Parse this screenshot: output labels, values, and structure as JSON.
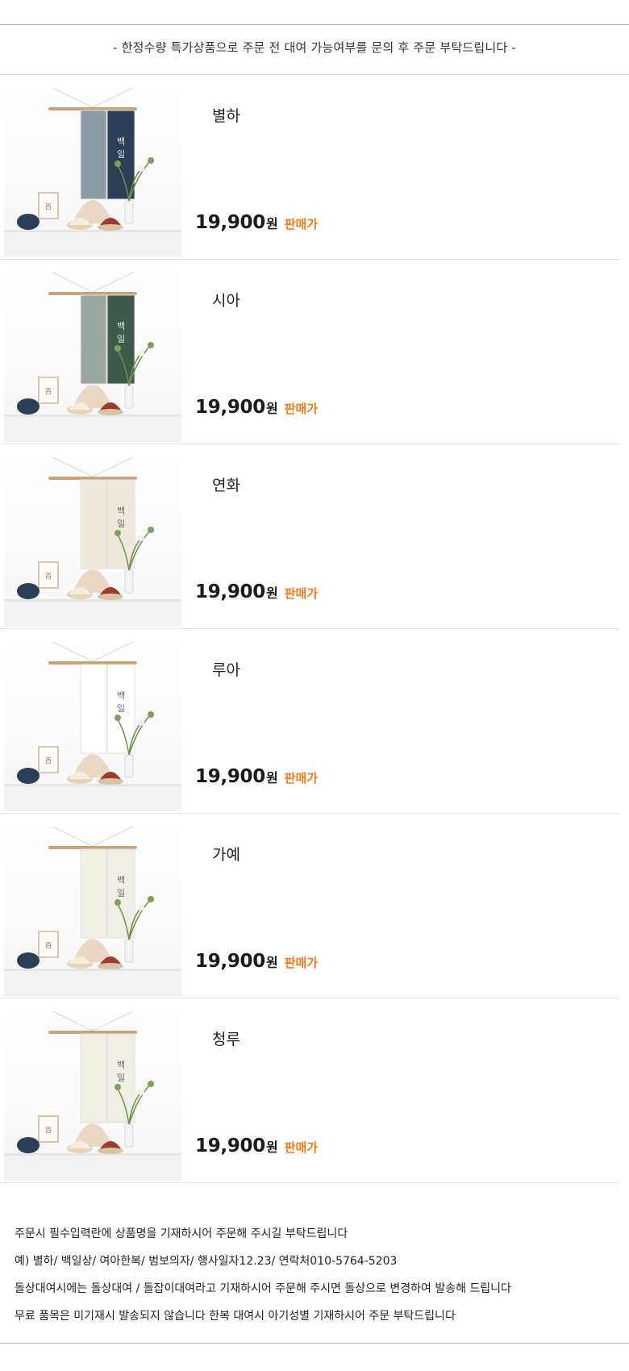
{
  "notice": "- 한정수량 특가상품으로 주문 전 대여 가능여부를 문의 후 주문 부탁드립니다 -",
  "products": [
    {
      "name": "별하",
      "price": "19,900",
      "unit": "원",
      "tag": "판매가",
      "banner_text": "백일",
      "banner_color": "#2c3e55",
      "panel_color": "#8e9aa3"
    },
    {
      "name": "시아",
      "price": "19,900",
      "unit": "원",
      "tag": "판매가",
      "banner_text": "백일",
      "banner_color": "#3e5a4a",
      "panel_color": "#9aa7a1"
    },
    {
      "name": "연화",
      "price": "19,900",
      "unit": "원",
      "tag": "판매가",
      "banner_text": "백일",
      "banner_color": "#efe9dc",
      "panel_color": "#efe9dc"
    },
    {
      "name": "루아",
      "price": "19,900",
      "unit": "원",
      "tag": "판매가",
      "banner_text": "백 일",
      "banner_color": "#ffffff",
      "panel_color": "#ffffff"
    },
    {
      "name": "가예",
      "price": "19,900",
      "unit": "원",
      "tag": "판매가",
      "banner_text": "백일",
      "banner_color": "#f1eee6",
      "panel_color": "#f1eee6"
    },
    {
      "name": "청루",
      "price": "19,900",
      "unit": "원",
      "tag": "판매가",
      "banner_text": "백일",
      "banner_color": "#f1eee6",
      "panel_color": "#f1eee6"
    }
  ],
  "footer": {
    "line1": "주문시 필수입력란에 상품명을 기재하시어 주문해 주시길 부탁드립니다",
    "line2": "예) 별하/ 백일상/ 여아한복/ 범보의자/ 행사일자12.23/ 연락처010-5764-5203",
    "line3": "돌상대여시에는 돌상대여 / 돌잡이대여라고 기재하시어 주문해 주시면 돌상으로 변경하여 발송해 드립니다",
    "line4": "무료 품목은 미기재시 발송되지 않습니다  한복 대여시 아기성별 기재하시어 주문 부탁드립니다"
  },
  "colors": {
    "price_tag": "#f07a1c",
    "text": "#222222"
  }
}
